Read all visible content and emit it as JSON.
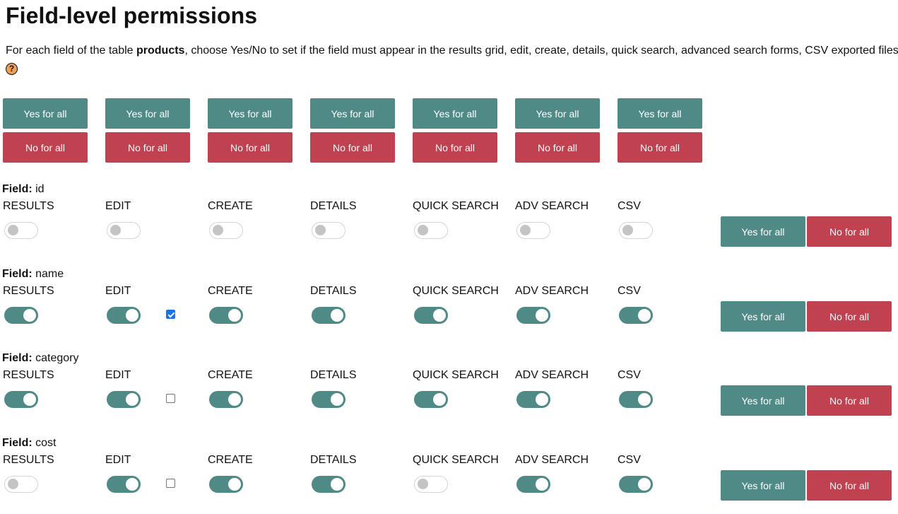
{
  "title": "Field-level permissions",
  "description": {
    "before": "For each field of the table ",
    "table": "products",
    "after": ", choose Yes/No to set if the field must appear in the results grid, edit, create, details, quick search, advanced search forms, CSV exported files."
  },
  "help_glyph": "?",
  "yes_all_label": "Yes for all",
  "no_all_label": "No for all",
  "field_prefix": "Field:",
  "columns": [
    "RESULTS",
    "EDIT",
    "CREATE",
    "DETAILS",
    "QUICK SEARCH",
    "ADV SEARCH",
    "CSV"
  ],
  "colors": {
    "on": "#508a86",
    "yes_button": "#508a86",
    "no_button": "#c04150",
    "checkbox": "#1a73e8"
  },
  "fields": [
    {
      "name": "id",
      "toggles": [
        false,
        false,
        false,
        false,
        false,
        false,
        false
      ],
      "edit_checkbox": null
    },
    {
      "name": "name",
      "toggles": [
        true,
        true,
        true,
        true,
        true,
        true,
        true
      ],
      "edit_checkbox": true
    },
    {
      "name": "category",
      "toggles": [
        true,
        true,
        true,
        true,
        true,
        true,
        true
      ],
      "edit_checkbox": false
    },
    {
      "name": "cost",
      "toggles": [
        false,
        true,
        true,
        true,
        false,
        true,
        true
      ],
      "edit_checkbox": false
    }
  ]
}
